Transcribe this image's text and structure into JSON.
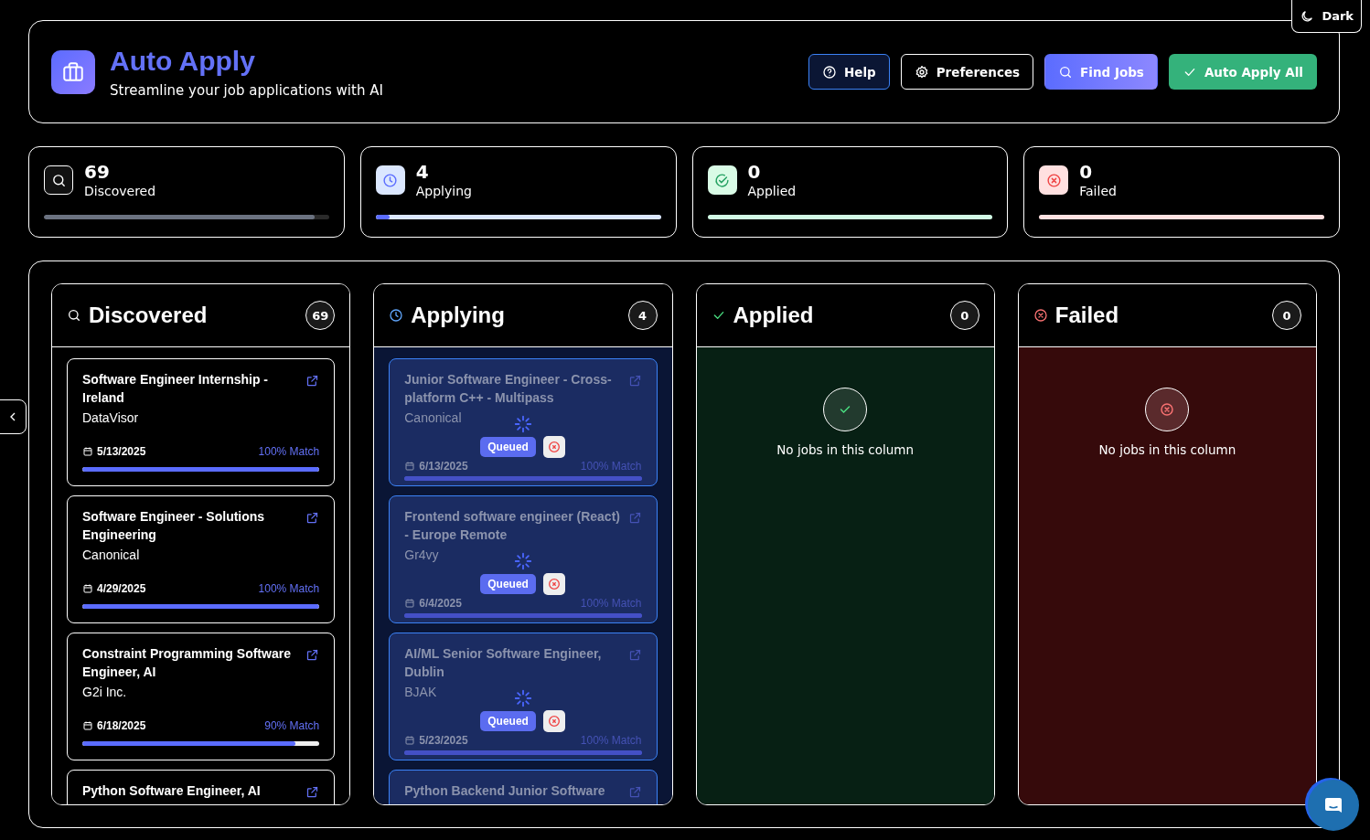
{
  "theme_toggle": {
    "label": "Dark"
  },
  "header": {
    "title": "Auto Apply",
    "subtitle": "Streamline your job applications with AI",
    "buttons": [
      {
        "label": "Help",
        "kind": "help"
      },
      {
        "label": "Preferences",
        "kind": "preferences"
      },
      {
        "label": "Find Jobs",
        "kind": "find"
      },
      {
        "label": "Auto Apply All",
        "kind": "apply"
      }
    ]
  },
  "stats": [
    {
      "kind": "discovered",
      "value": "69",
      "label": "Discovered",
      "level": 0.95
    },
    {
      "kind": "applying",
      "value": "4",
      "label": "Applying",
      "level": 0.05
    },
    {
      "kind": "applied",
      "value": "0",
      "label": "Applied",
      "level": 0
    },
    {
      "kind": "failed",
      "value": "0",
      "label": "Failed",
      "level": 0
    }
  ],
  "columns": [
    {
      "kind": "discovered",
      "title": "Discovered",
      "count": "69",
      "jobs": [
        {
          "title": "Software Engineer Internship - Ireland",
          "company": "DataVisor",
          "date": "5/13/2025",
          "match": "100% Match",
          "level": 1,
          "processing": false
        },
        {
          "title": "Software Engineer - Solutions Engineering",
          "company": "Canonical",
          "date": "4/29/2025",
          "match": "100% Match",
          "level": 1,
          "processing": false
        },
        {
          "title": "Constraint Programming Software Engineer, AI",
          "company": "G2i Inc.",
          "date": "6/18/2025",
          "match": "90% Match",
          "level": 0.9,
          "processing": false
        },
        {
          "title": "Python Software Engineer, AI",
          "processing": false
        }
      ]
    },
    {
      "kind": "applying",
      "title": "Applying",
      "count": "4",
      "jobs": [
        {
          "title": "Junior Software Engineer - Cross-platform C++ - Multipass",
          "company": "Canonical",
          "date": "6/13/2025",
          "match": "100% Match",
          "level": 1,
          "status": "Queued",
          "processing": true
        },
        {
          "title": "Frontend software engineer (React) - Europe Remote",
          "company": "Gr4vy",
          "date": "6/4/2025",
          "match": "100% Match",
          "level": 1,
          "status": "Queued",
          "processing": true
        },
        {
          "title": "AI/ML Senior Software Engineer, Dublin",
          "company": "BJAK",
          "date": "5/23/2025",
          "match": "100% Match",
          "level": 1,
          "status": "Queued",
          "processing": true
        },
        {
          "title": "Python Backend Junior Software",
          "processing": true
        }
      ]
    },
    {
      "kind": "applied",
      "title": "Applied",
      "count": "0",
      "empty_text": "No jobs in this column"
    },
    {
      "kind": "failed",
      "title": "Failed",
      "count": "0",
      "empty_text": "No jobs in this column"
    }
  ]
}
